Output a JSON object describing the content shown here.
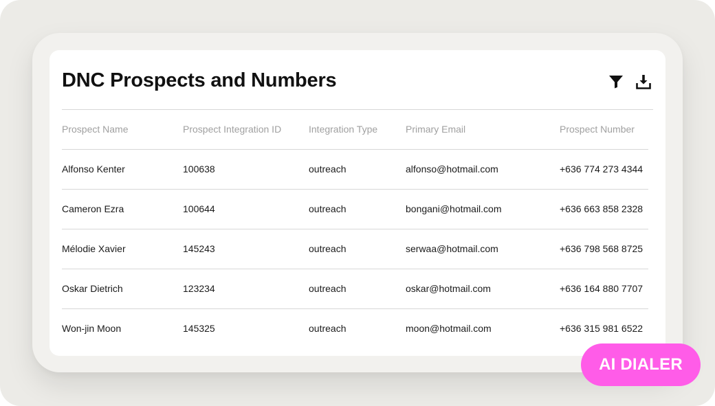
{
  "card": {
    "title": "DNC Prospects and Numbers",
    "actions": [
      {
        "icon": "filter-icon"
      },
      {
        "icon": "download-icon"
      }
    ]
  },
  "table": {
    "columns": [
      "Prospect Name",
      "Prospect Integration ID",
      "Integration Type",
      "Primary Email",
      "Prospect Number"
    ],
    "rows": [
      [
        "Alfonso Kenter",
        "100638",
        "outreach",
        "alfonso@hotmail.com",
        "+636 774 273 4344"
      ],
      [
        "Cameron Ezra",
        "100644",
        "outreach",
        "bongani@hotmail.com",
        "+636 663 858 2328"
      ],
      [
        "Mélodie Xavier",
        "145243",
        "outreach",
        "serwaa@hotmail.com",
        "+636 798 568 8725"
      ],
      [
        "Oskar Dietrich",
        "123234",
        "outreach",
        "oskar@hotmail.com",
        "+636 164 880 7707"
      ],
      [
        "Won-jin Moon",
        "145325",
        "outreach",
        "moon@hotmail.com",
        "+636 315 981 6522"
      ]
    ]
  },
  "badge": {
    "label": "AI DIALER",
    "color": "#ff5ce8"
  }
}
